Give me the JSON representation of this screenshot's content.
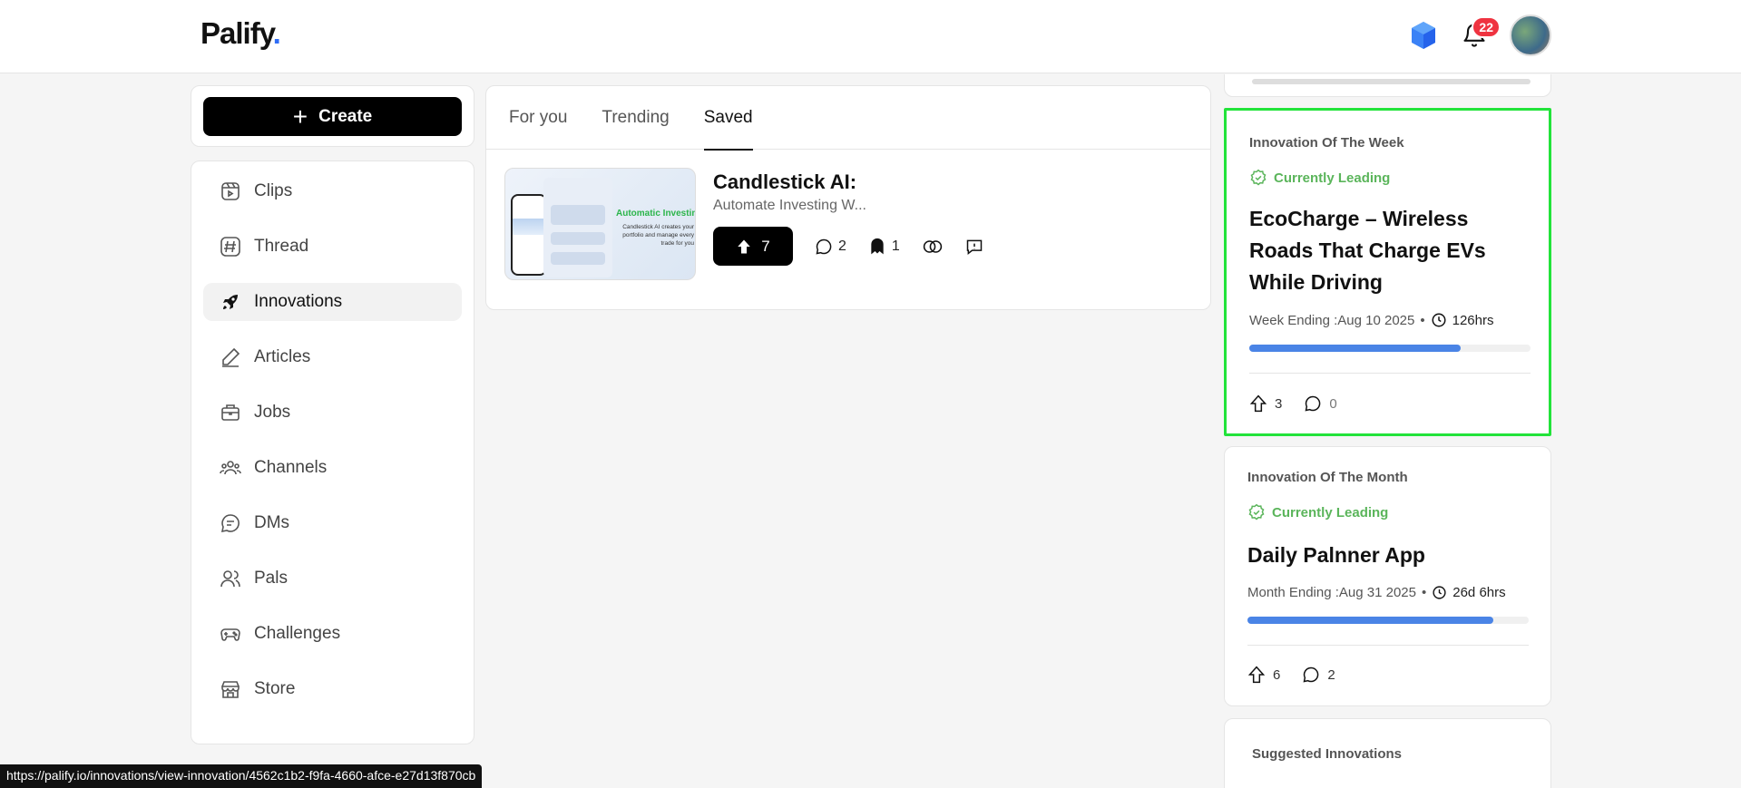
{
  "header": {
    "logo": "Palify",
    "logo_dot": ".",
    "notification_count": "22"
  },
  "create": {
    "label": "Create"
  },
  "sidebar": {
    "items": [
      {
        "label": "Clips",
        "icon": "clips-icon"
      },
      {
        "label": "Thread",
        "icon": "hash-icon"
      },
      {
        "label": "Innovations",
        "icon": "rocket-icon",
        "active": true
      },
      {
        "label": "Articles",
        "icon": "pen-icon"
      },
      {
        "label": "Jobs",
        "icon": "briefcase-icon"
      },
      {
        "label": "Channels",
        "icon": "users-icon"
      },
      {
        "label": "DMs",
        "icon": "chat-icon"
      },
      {
        "label": "Pals",
        "icon": "pals-icon"
      },
      {
        "label": "Challenges",
        "icon": "gamepad-icon"
      },
      {
        "label": "Store",
        "icon": "store-icon"
      }
    ]
  },
  "feed": {
    "tabs": [
      {
        "label": "For you"
      },
      {
        "label": "Trending"
      },
      {
        "label": "Saved",
        "active": true
      }
    ],
    "post": {
      "title": "Candlestick AI:",
      "subtitle": "Automate Investing W...",
      "upvotes": "7",
      "comments": "2",
      "bookmarks": "1",
      "thumb_text": "Automatic Investing",
      "thumb_caption": "Candlestick AI creates your portfolio and manage every trade for you"
    }
  },
  "innovation_week": {
    "heading": "Innovation Of The Week",
    "leading": "Currently Leading",
    "title": "EcoCharge – Wireless Roads That Charge EVs While Driving",
    "ending": "Week Ending :Aug 10 2025",
    "bullet": "•",
    "time_left": "126hrs",
    "progress": 0.75,
    "upvotes": "3",
    "comments": "0"
  },
  "innovation_month": {
    "heading": "Innovation Of The Month",
    "leading": "Currently Leading",
    "title": "Daily Palnner App",
    "ending": "Month Ending :Aug 31 2025",
    "bullet": "•",
    "time_left": "26d 6hrs",
    "progress": 0.875,
    "upvotes": "6",
    "comments": "2"
  },
  "suggested": {
    "heading": "Suggested Innovations"
  },
  "status_url": "https://palify.io/innovations/view-innovation/4562c1b2-f9fa-4660-afce-e27d13f870cb",
  "colors": {
    "accent_blue": "#4a84e6",
    "leading_green": "#5bb55b",
    "badge_red": "#ef3340",
    "highlight": "#22e33a"
  }
}
